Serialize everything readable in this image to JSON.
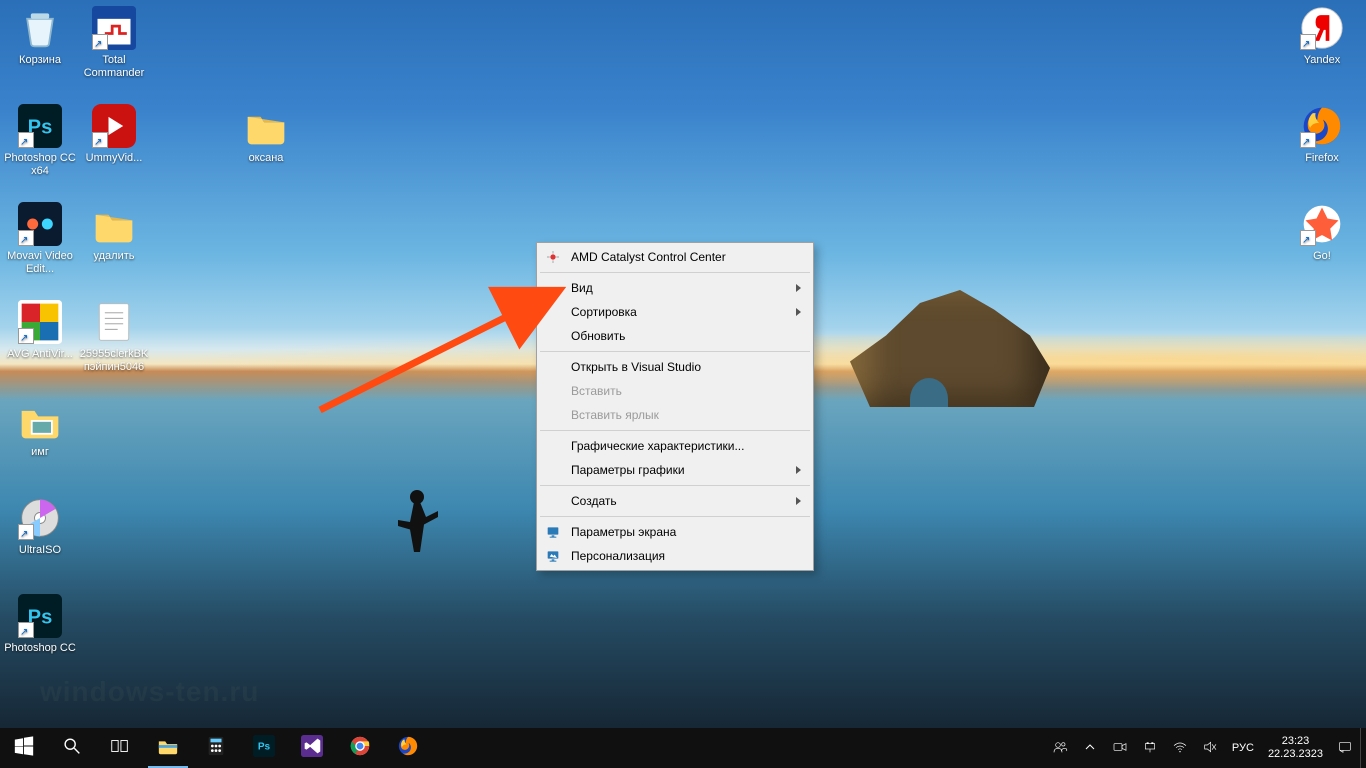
{
  "desktop_icons": {
    "col1": [
      {
        "label": "Корзина",
        "kind": "recycle"
      },
      {
        "label": "Photoshop CC x64",
        "kind": "ps"
      },
      {
        "label": "Movavi Video Edit...",
        "kind": "movavi"
      },
      {
        "label": "AVG AntiVir...",
        "kind": "avg"
      },
      {
        "label": "имг",
        "kind": "folder-img"
      },
      {
        "label": "UltraISO",
        "kind": "disc"
      },
      {
        "label": "Photoshop CC",
        "kind": "ps"
      }
    ],
    "col2": [
      {
        "label": "Total Commander",
        "kind": "tc"
      },
      {
        "label": "UmmyVid...",
        "kind": "ummy"
      },
      {
        "label": "удалить",
        "kind": "folder"
      },
      {
        "label": "25955clerkBK пэйпин5046",
        "kind": "txt"
      }
    ],
    "col3": [
      {
        "label": "оксана",
        "kind": "folder"
      }
    ],
    "right": [
      {
        "label": "Yandex",
        "kind": "yandex"
      },
      {
        "label": "Firefox",
        "kind": "firefox"
      },
      {
        "label": "Go!",
        "kind": "go"
      }
    ]
  },
  "context_menu": {
    "items": [
      {
        "label": "AMD Catalyst Control Center",
        "icon": "amd"
      },
      "---",
      {
        "label": "Вид",
        "submenu": true
      },
      {
        "label": "Сортировка",
        "submenu": true
      },
      {
        "label": "Обновить"
      },
      "---",
      {
        "label": "Открыть в Visual Studio"
      },
      {
        "label": "Вставить",
        "disabled": true
      },
      {
        "label": "Вставить ярлык",
        "disabled": true
      },
      "---",
      {
        "label": "Графические характеристики..."
      },
      {
        "label": "Параметры графики",
        "submenu": true
      },
      "---",
      {
        "label": "Создать",
        "submenu": true
      },
      "---",
      {
        "label": "Параметры экрана",
        "icon": "display"
      },
      {
        "label": "Персонализация",
        "icon": "personalize"
      }
    ]
  },
  "taskbar": {
    "pinned": [
      {
        "name": "start",
        "kind": "winlogo"
      },
      {
        "name": "search",
        "kind": "search"
      },
      {
        "name": "taskview",
        "kind": "taskview"
      },
      {
        "name": "explorer",
        "kind": "explorer",
        "active": true
      },
      {
        "name": "calculator",
        "kind": "calc"
      },
      {
        "name": "photoshop",
        "kind": "ps"
      },
      {
        "name": "visualstudio",
        "kind": "vs"
      },
      {
        "name": "chrome",
        "kind": "chrome"
      },
      {
        "name": "firefox",
        "kind": "firefox"
      }
    ],
    "tray": {
      "people": true,
      "chevron": true,
      "video": true,
      "power": true,
      "wifi": true,
      "volume_muted": true,
      "lang": "РУС",
      "time": "23:23",
      "date": "22.23.2323",
      "notifications": true
    }
  },
  "watermark": "windows-ten.ru"
}
